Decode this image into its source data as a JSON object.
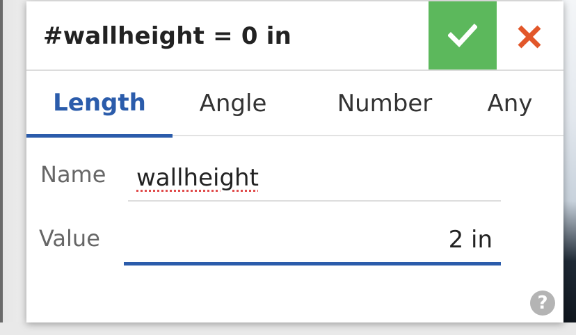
{
  "dialog": {
    "title": "#wallheight = 0 in",
    "accept_icon": "check-icon",
    "cancel_icon": "close-icon",
    "accept_color": "#5cb85c",
    "cancel_color": "#e2572a"
  },
  "tabs": [
    {
      "label": "Length",
      "active": true
    },
    {
      "label": "Angle",
      "active": false
    },
    {
      "label": "Number",
      "active": false
    },
    {
      "label": "Any",
      "active": false
    }
  ],
  "accent_color": "#2b5cab",
  "form": {
    "name_label": "Name",
    "name_value": "wallheight",
    "value_label": "Value",
    "value_value": "2 in"
  },
  "help": {
    "icon": "help-icon",
    "glyph": "?"
  }
}
